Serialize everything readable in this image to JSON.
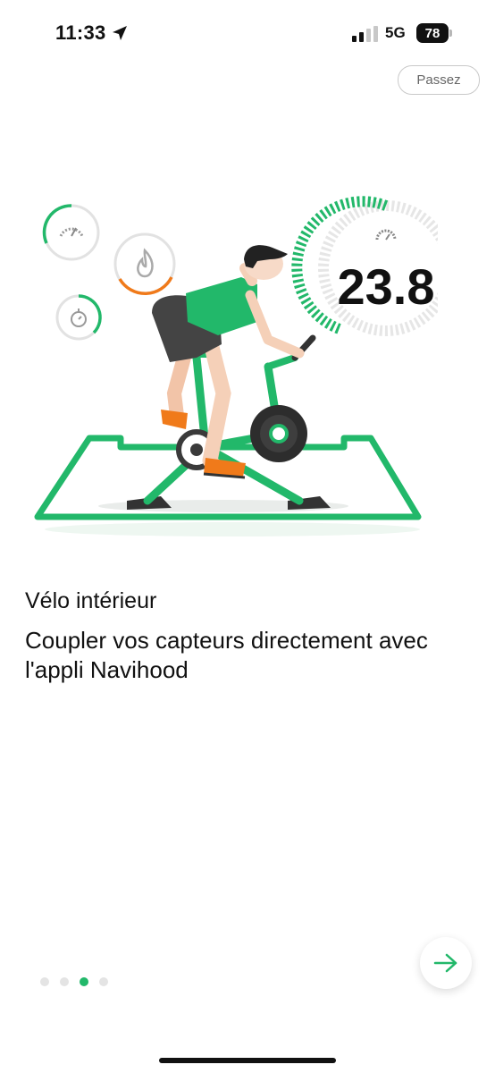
{
  "status_bar": {
    "time": "11:33",
    "network": "5G",
    "battery": "78",
    "icons": [
      "location-arrow-icon",
      "signal-bars-icon",
      "battery-icon"
    ]
  },
  "skip_label": "Passez",
  "illustration": {
    "speed_value": "23.8",
    "icons": [
      "speedometer-icon",
      "flame-icon",
      "stopwatch-icon",
      "cyclist-illustration"
    ]
  },
  "onboarding": {
    "title": "Vélo intérieur",
    "description": "Coupler vos capteurs directement avec l'appli Navihood"
  },
  "pager": {
    "count": 4,
    "active_index": 2
  },
  "next_icon": "arrow-right-icon",
  "colors": {
    "accent": "#22b86a",
    "orange": "#f07a1a",
    "text": "#111111"
  }
}
